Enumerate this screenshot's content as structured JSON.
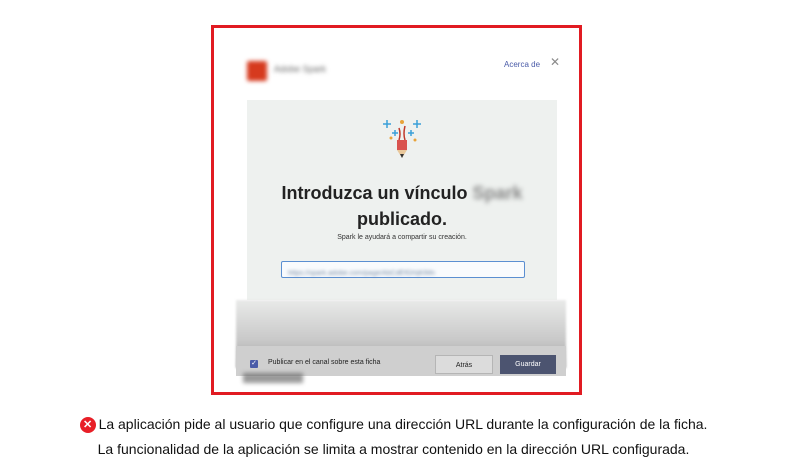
{
  "dialog": {
    "app_name": "Adobe Spark",
    "about_link": "Acerca de",
    "close_icon": "close-icon",
    "heading_line1": "Introduzca un vínculo",
    "heading_blurred": "Spark",
    "heading_line2": "publicado.",
    "subtext": "Spark le ayudará a compartir su creación.",
    "url_input_value": "https://spark.adobe.com/page/AbCdEfGhIjKlMn",
    "checkbox_label": "Publicar en el canal sobre esta ficha",
    "back_button": "Atrás",
    "save_button": "Guardar"
  },
  "caption": {
    "status_icon": "error-icon",
    "line1": "La aplicación pide al usuario que configure una dirección URL durante la configuración de la ficha.",
    "line2": "La funcionalidad de la aplicación se limita a mostrar contenido en la dirección URL configurada."
  },
  "colors": {
    "frame_border": "#e11b22",
    "accent": "#4a5ba8",
    "error": "#e81f27"
  }
}
